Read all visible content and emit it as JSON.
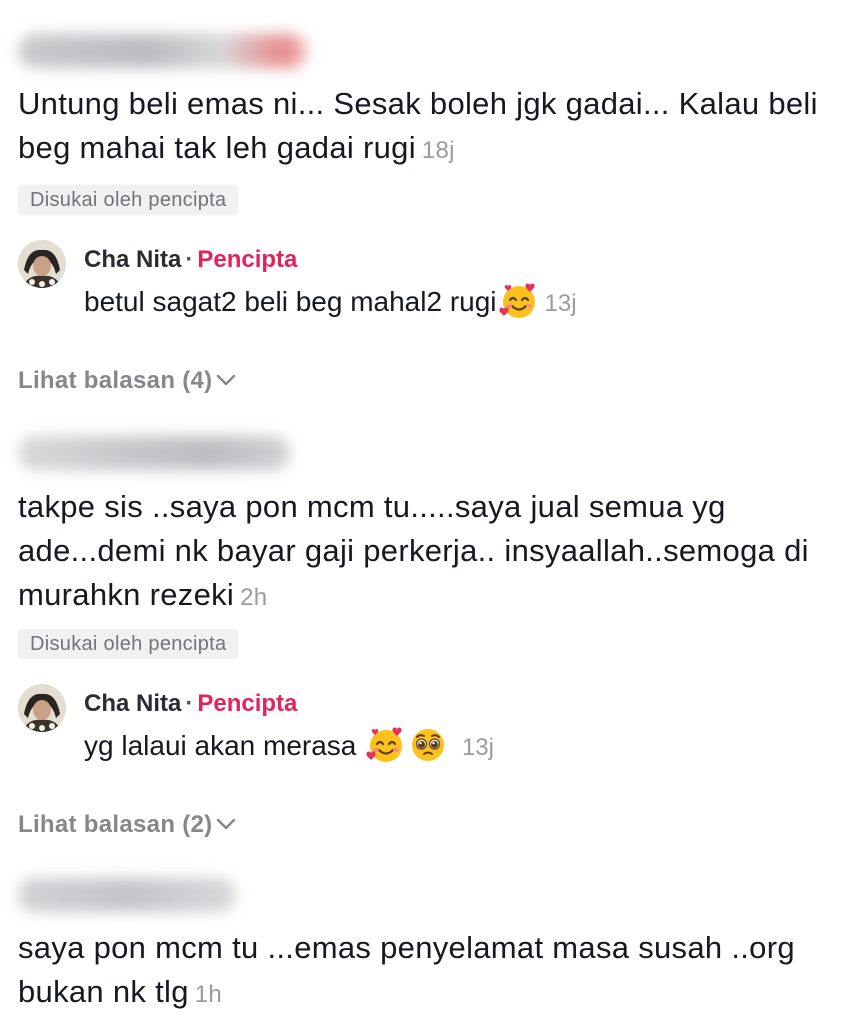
{
  "comments": [
    {
      "text": "Untung beli emas ni... Sesak boleh jgk gadai... Kalau beli beg mahai tak leh gadai rugi",
      "time": "18j",
      "liked_label": "Disukai oleh pencipta",
      "reply": {
        "author": "Cha Nita",
        "separator": "·",
        "role": "Pencipta",
        "text": "betul sagat2 beli beg mahal2 rugi",
        "emojis": [
          "smiling-face-with-hearts"
        ],
        "time": "13j"
      },
      "view_replies": "Lihat balasan (4)"
    },
    {
      "text": "takpe sis ..saya pon mcm tu.....saya jual semua yg ade...demi nk bayar gaji perkerja.. insyaallah..semoga di murahkn rezeki",
      "time": "2h",
      "liked_label": "Disukai oleh pencipta",
      "reply": {
        "author": "Cha Nita",
        "separator": "·",
        "role": "Pencipta",
        "text": "yg lalaui akan merasa",
        "emojis": [
          "smiling-face-with-hearts",
          "pleading-face"
        ],
        "time": "13j"
      },
      "view_replies": "Lihat balasan (2)"
    },
    {
      "text": "saya pon mcm tu ...emas penyelamat masa susah ..org bukan nk tlg",
      "time": "1h"
    }
  ],
  "colors": {
    "text": "#161823",
    "muted": "#9a9ba1",
    "creator": "#e0245e",
    "chip_bg": "#f1f1f2"
  }
}
